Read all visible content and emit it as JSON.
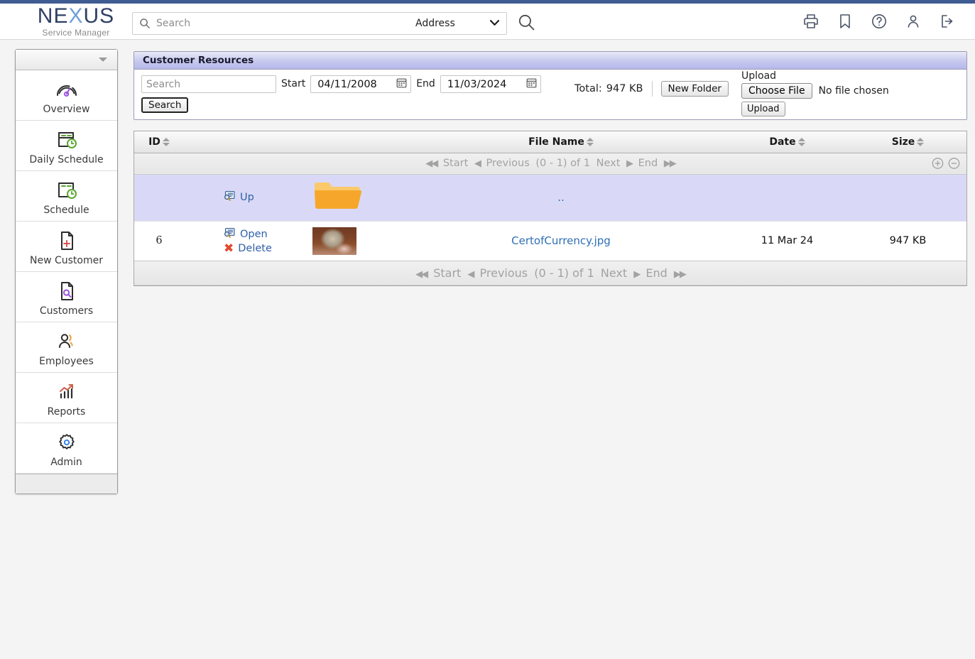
{
  "brand": {
    "logo_part1": "NE",
    "logo_x": "X",
    "logo_part2": "US",
    "tagline": "Service Manager",
    "accent_blue": "#3f5c93",
    "logo_light_blue": "#6f9fd8"
  },
  "search": {
    "placeholder": "Search",
    "value": "",
    "scope_selected": "Address",
    "scope_options": [
      "Address"
    ],
    "icon": "search-icon",
    "go_icon": "search-icon"
  },
  "header_icons": [
    {
      "name": "print-icon",
      "title": "Print"
    },
    {
      "name": "bookmark-icon",
      "title": "Bookmark"
    },
    {
      "name": "help-icon",
      "title": "Help"
    },
    {
      "name": "user-icon",
      "title": "Account"
    },
    {
      "name": "logout-icon",
      "title": "Log out"
    }
  ],
  "sidebar": {
    "collapse_icon": "chevron-down-icon",
    "items": [
      {
        "label": "Overview",
        "icon": "gauge-icon"
      },
      {
        "label": "Daily Schedule",
        "icon": "calendar-clock-icon"
      },
      {
        "label": "Schedule",
        "icon": "calendar-clock-icon"
      },
      {
        "label": "New Customer",
        "icon": "document-plus-icon"
      },
      {
        "label": "Customers",
        "icon": "document-search-icon"
      },
      {
        "label": "Employees",
        "icon": "people-icon"
      },
      {
        "label": "Reports",
        "icon": "chart-trend-icon"
      },
      {
        "label": "Admin",
        "icon": "gear-icon"
      }
    ]
  },
  "panel": {
    "title": "Customer Resources",
    "filters": {
      "search_placeholder": "Search",
      "search_value": "",
      "start_label": "Start",
      "start_value": "04/11/2008",
      "end_label": "End",
      "end_value": "11/03/2024",
      "calendar_icon": "calendar-icon",
      "search_button": "Search"
    },
    "total_label": "Total:",
    "total_value": "947 KB",
    "new_folder_button": "New Folder",
    "upload": {
      "label": "Upload",
      "choose_file_button": "Choose File",
      "no_file_text": "No file chosen",
      "upload_button": "Upload"
    }
  },
  "table": {
    "columns": [
      {
        "key": "id",
        "label": "ID",
        "sort_icon": "sort-arrows-icon"
      },
      {
        "key": "actions",
        "label": ""
      },
      {
        "key": "thumb",
        "label": ""
      },
      {
        "key": "name",
        "label": "File Name",
        "sort_icon": "sort-arrows-icon"
      },
      {
        "key": "date",
        "label": "Date",
        "sort_icon": "sort-arrows-icon"
      },
      {
        "key": "size",
        "label": "Size",
        "sort_icon": "sort-arrows-icon"
      }
    ],
    "pager": {
      "first_icon": "first-page-icon",
      "start": "Start",
      "prev_icon": "previous-icon",
      "previous": "Previous",
      "range": "(0 - 1) of 1",
      "next": "Next",
      "next_icon": "next-icon",
      "end": "End",
      "last_icon": "last-page-icon",
      "zoom_in_icon": "zoom-in-icon",
      "zoom_out_icon": "zoom-out-icon"
    },
    "rows": [
      {
        "type": "up",
        "id": "",
        "action_primary": "Up",
        "action_primary_icon": "preview-icon",
        "thumb": "folder-icon",
        "name": "..",
        "date": "",
        "size": ""
      },
      {
        "type": "file",
        "id": "6",
        "action_primary": "Open",
        "action_primary_icon": "preview-icon",
        "action_secondary": "Delete",
        "action_secondary_icon": "delete-x-icon",
        "thumb": "image-thumbnail",
        "name": "CertofCurrency.jpg",
        "date": "11 Mar 24",
        "size": "947 KB"
      }
    ]
  }
}
